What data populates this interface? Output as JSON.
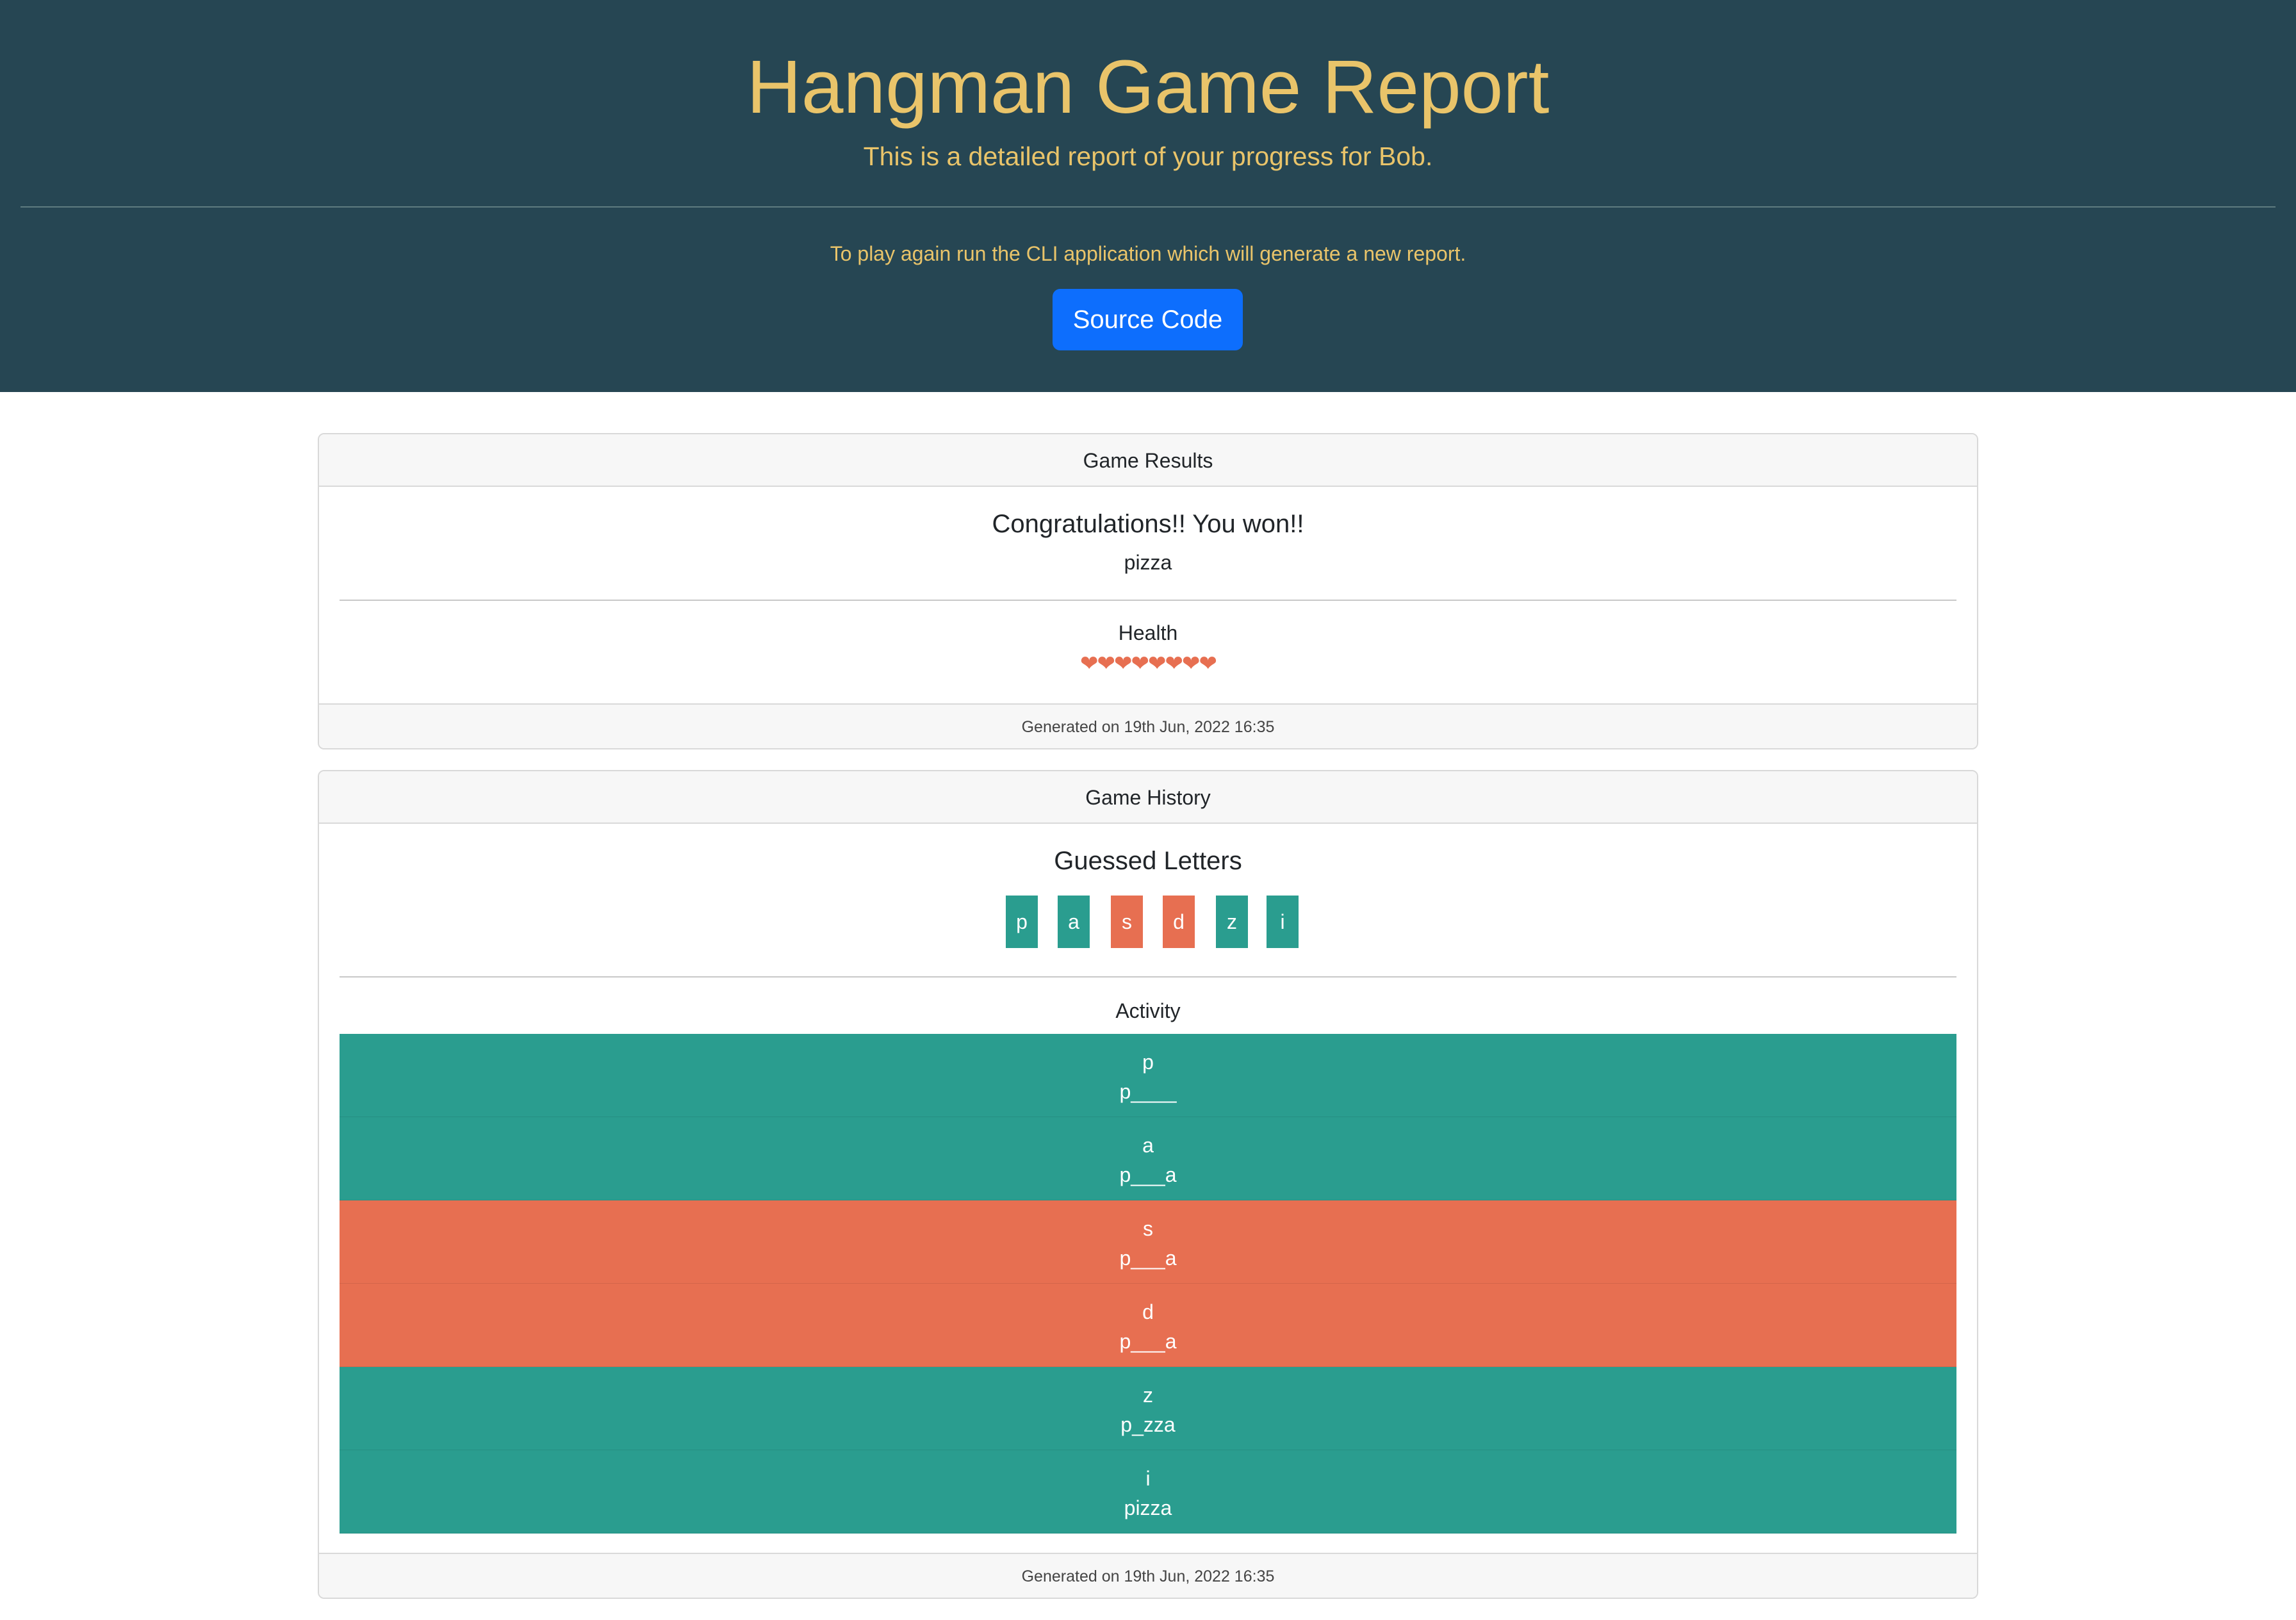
{
  "header": {
    "title": "Hangman Game Report",
    "lead": "This is a detailed report of your progress for Bob.",
    "note": "To play again run the CLI application which will generate a new report.",
    "button_label": "Source Code"
  },
  "results": {
    "header": "Game Results",
    "message": "Congratulations!! You won!!",
    "word": "pizza",
    "health_label": "Health",
    "hearts": "❤❤❤❤❤❤❤❤",
    "footer": "Generated on 19th Jun, 2022 16:35"
  },
  "history": {
    "header": "Game History",
    "guessed_title": "Guessed Letters",
    "letters": [
      {
        "letter": "p",
        "status": "correct"
      },
      {
        "letter": "a",
        "status": "correct"
      },
      {
        "letter": "s",
        "status": "wrong"
      },
      {
        "letter": "d",
        "status": "wrong"
      },
      {
        "letter": "z",
        "status": "correct"
      },
      {
        "letter": "i",
        "status": "correct"
      }
    ],
    "activity_label": "Activity",
    "activity": [
      {
        "guess": "p",
        "state": "p____",
        "status": "correct"
      },
      {
        "guess": "a",
        "state": "p___a",
        "status": "correct"
      },
      {
        "guess": "s",
        "state": "p___a",
        "status": "wrong"
      },
      {
        "guess": "d",
        "state": "p___a",
        "status": "wrong"
      },
      {
        "guess": "z",
        "state": "p_zza",
        "status": "correct"
      },
      {
        "guess": "i",
        "state": "pizza",
        "status": "correct"
      }
    ],
    "footer": "Generated on 19th Jun, 2022 16:35"
  },
  "colors": {
    "header_bg": "#264653",
    "accent_text": "#e9c46a",
    "correct": "#2a9d8f",
    "wrong": "#e76f51",
    "button": "#0d6efd"
  }
}
